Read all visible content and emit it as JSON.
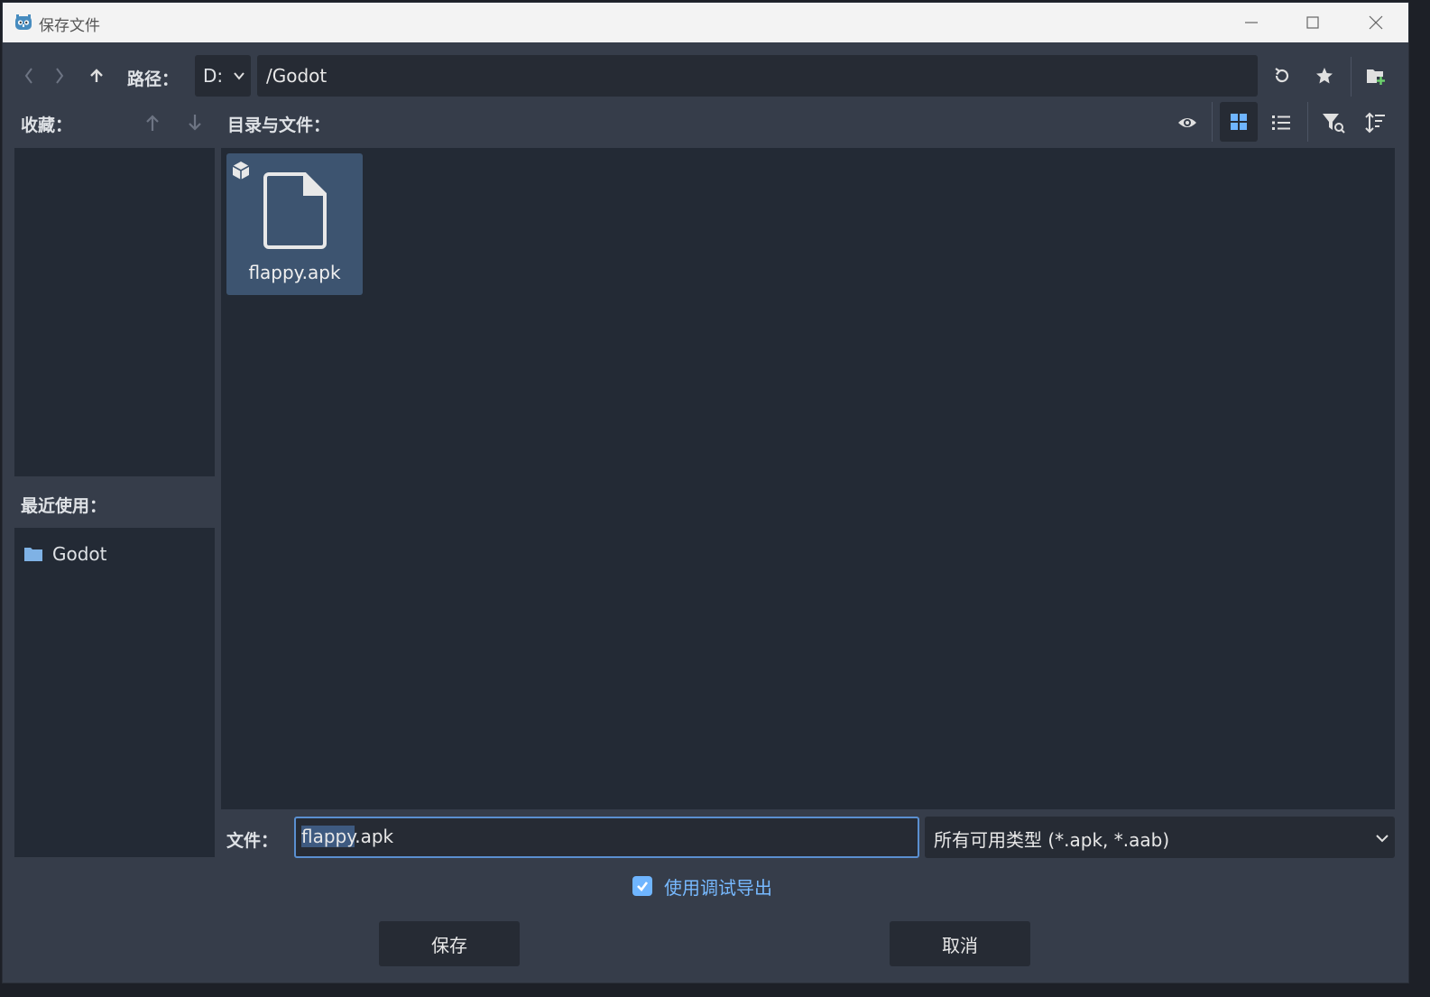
{
  "window": {
    "title": "保存文件",
    "controls": {
      "minimize": "minimize-icon",
      "maximize": "maximize-icon",
      "close": "close-icon"
    }
  },
  "toolbar": {
    "path_label": "路径：",
    "drive": "D:",
    "path": "/Godot",
    "icons": [
      "chevron-left-icon",
      "chevron-right-icon",
      "arrow-up-icon",
      "refresh-icon",
      "star-icon",
      "new-folder-icon"
    ]
  },
  "favorites": {
    "label": "收藏：",
    "items": []
  },
  "recent": {
    "label": "最近使用：",
    "items": [
      {
        "name": "Godot",
        "icon": "folder-icon"
      }
    ]
  },
  "files": {
    "label": "目录与文件：",
    "view_mode": "grid",
    "items": [
      {
        "name": "flappy.apk",
        "icon": "file-icon",
        "badge": "package-icon"
      }
    ],
    "toolbar_icons": [
      "eye-icon",
      "grid-view-icon",
      "list-view-icon",
      "filter-icon",
      "sort-icon"
    ]
  },
  "file_field": {
    "label": "文件：",
    "value": "flappy.apk",
    "selected_text": "flappy",
    "rest_text": ".apk"
  },
  "file_type": {
    "selected": "所有可用类型 (*.apk, *.aab)"
  },
  "debug_export": {
    "label": "使用调试导出",
    "checked": true
  },
  "buttons": {
    "save": "保存",
    "cancel": "取消"
  },
  "colors": {
    "accent": "#6fb5ff",
    "folder": "#7fb2e5",
    "bg": "#363d4a",
    "panel": "#232a35",
    "new_folder_plus": "#6dd36d"
  }
}
